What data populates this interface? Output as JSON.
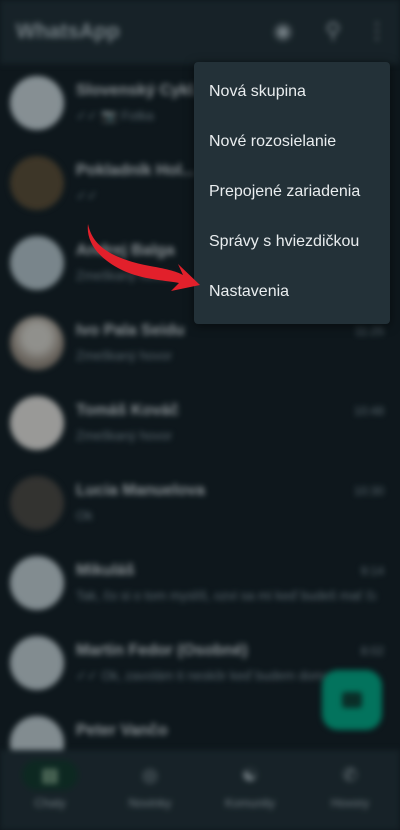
{
  "app": {
    "title": "WhatsApp",
    "icons": [
      "camera-icon",
      "search-icon",
      "more-vert-icon"
    ]
  },
  "chats": [
    {
      "name": "Slovenský Cykl...",
      "preview": "✓✓ 📷 Fotka",
      "time": "",
      "avatar": "light"
    },
    {
      "name": "Pokladník Hol...",
      "preview": "✓✓",
      "time": "",
      "avatar": "dark"
    },
    {
      "name": "Andrej Balga",
      "preview": "Zmeškaný hovor",
      "time": "",
      "avatar": "light"
    },
    {
      "name": "Ivo Pala Seidu",
      "preview": "Zmeškaný hovor",
      "time": "11:25",
      "avatar": "photo"
    },
    {
      "name": "Tomáš Kováč",
      "preview": "Zmeškaný hovor",
      "time": "10:48",
      "avatar": "photo"
    },
    {
      "name": "Lucia Manuelova",
      "preview": "Ok",
      "time": "10:30",
      "avatar": "dark"
    },
    {
      "name": "Mikuláš",
      "preview": "Tak, čo si o tom myslíš, ozvi sa mi keď budeš mať čas",
      "time": "9:14",
      "avatar": "light"
    },
    {
      "name": "Martin Fedor (Osobné)",
      "preview": "✓✓ Ok, zavolám ti neskôr keď budem doma",
      "time": "8:02",
      "avatar": "light"
    },
    {
      "name": "Peter Vančo",
      "preview": "",
      "time": "",
      "avatar": "light"
    }
  ],
  "bottom_nav": [
    {
      "label": "Chaty",
      "icon": "chat-icon",
      "active": true
    },
    {
      "label": "Novinky",
      "icon": "updates-icon",
      "active": false
    },
    {
      "label": "Komunity",
      "icon": "communities-icon",
      "active": false
    },
    {
      "label": "Hovory",
      "icon": "phone-icon",
      "active": false
    }
  ],
  "menu": {
    "items": [
      "Nová skupina",
      "Nové rozosielanie",
      "Prepojené zariadenia",
      "Správy s hviezdičkou",
      "Nastavenia"
    ]
  },
  "annotation": {
    "arrow_color": "#e2202b"
  }
}
